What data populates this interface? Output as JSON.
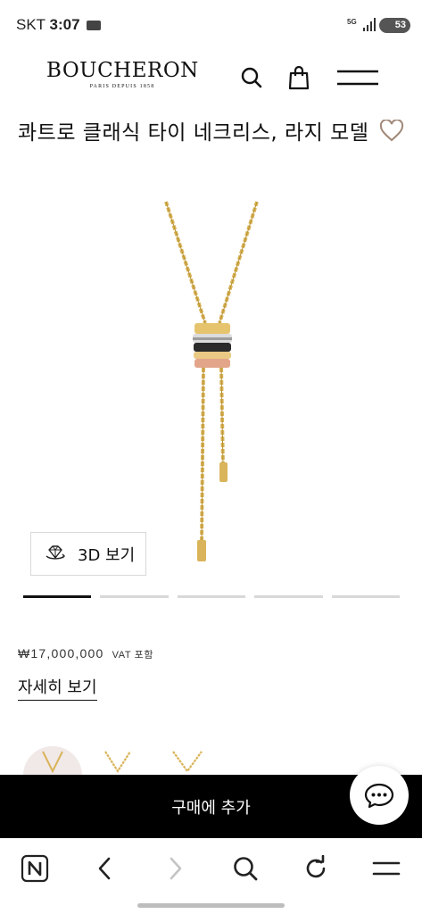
{
  "status_bar": {
    "carrier": "SKT",
    "time": "3:07",
    "network": "5G",
    "battery": "53"
  },
  "header": {
    "brand": "BOUCHERON",
    "brand_sub": "PARIS DEPUIS 1858",
    "icons": [
      "search-icon",
      "shopping-bag-icon",
      "menu-icon"
    ]
  },
  "product": {
    "title": "콰트로 클래식 타이 네크리스, 라지 모델",
    "view_3d_label": "3D 보기",
    "price": "₩17,000,000",
    "vat_label": "VAT 포함",
    "details_link": "자세히 보기",
    "carousel": {
      "slides": 5,
      "active": 1
    },
    "variants": [
      "rose-gold",
      "yellow-gold",
      "yellow-gold-diamond"
    ]
  },
  "cta": {
    "add_to_cart": "구매에 추가"
  },
  "browser_nav": {
    "icons": [
      "naver-home-icon",
      "back-icon",
      "forward-icon",
      "search-icon",
      "refresh-icon",
      "menu-icon"
    ]
  },
  "colors": {
    "accent": "#000000",
    "heart": "#a08878",
    "gold": "#d9b45a",
    "rose_gold": "#e3a58a"
  }
}
